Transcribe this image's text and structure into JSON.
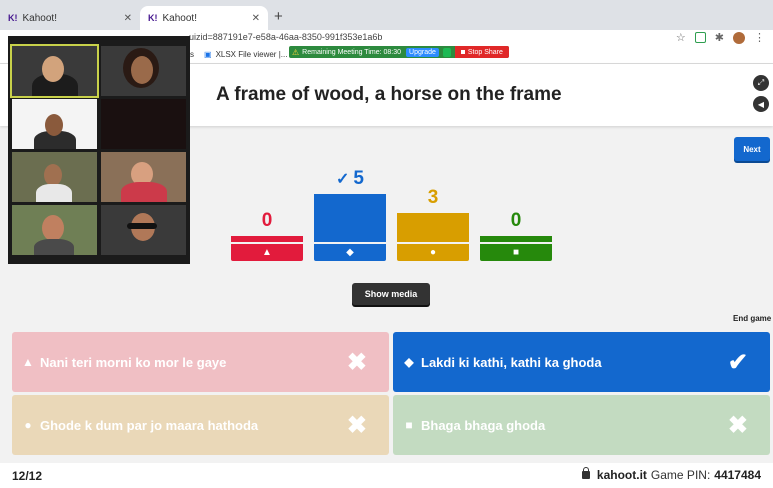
{
  "browser": {
    "tabs": [
      {
        "label": "Kahoot!",
        "logo": "K!"
      },
      {
        "label": "Kahoot!",
        "logo": "K!"
      }
    ],
    "new_tab": "+",
    "url": "uizid=887191e7-e58a-46aa-8350-991f353e1a6b",
    "bookmarks": [
      {
        "label": "s"
      },
      {
        "label": "XLSX File viewer |..."
      }
    ]
  },
  "zoom": {
    "remaining_time": "Remaining Meeting Time: 08:30",
    "upgrade": "Upgrade",
    "stop_share": "Stop Share"
  },
  "question": {
    "text": "A frame of wood, a horse on the frame"
  },
  "controls": {
    "next": "Next",
    "show_media": "Show media",
    "end_game": "End game"
  },
  "results": [
    {
      "count": "0",
      "color": "#e21b3c",
      "shape": "▲",
      "correct": false,
      "value": 0
    },
    {
      "count": "5",
      "color": "#1368ce",
      "shape": "◆",
      "correct": true,
      "value": 5
    },
    {
      "count": "3",
      "color": "#d89e00",
      "shape": "●",
      "correct": false,
      "value": 3
    },
    {
      "count": "0",
      "color": "#26890c",
      "shape": "■",
      "correct": false,
      "value": 0
    }
  ],
  "correct_mark": "✓",
  "answers": [
    {
      "text": "Nani teri morni ko mor le gaye",
      "shape": "▲",
      "mark": "✖"
    },
    {
      "text": "Lakdi ki kathi, kathi ka ghoda",
      "shape": "◆",
      "mark": "✔"
    },
    {
      "text": "Ghode k dum par jo maara hathoda",
      "shape": "●",
      "mark": "✖"
    },
    {
      "text": "Bhaga bhaga ghoda",
      "shape": "■",
      "mark": "✖"
    }
  ],
  "footer": {
    "progress": "12/12",
    "site": "kahoot.it",
    "pin_label": "Game PIN:",
    "pin": "4417484"
  }
}
